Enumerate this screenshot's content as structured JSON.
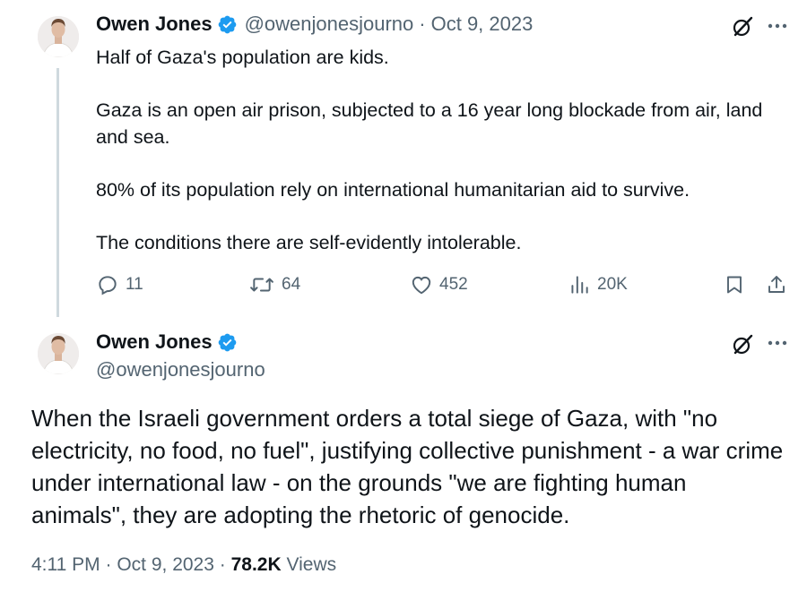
{
  "tweet1": {
    "author_name": "Owen Jones",
    "handle": "@owenjonesjourno",
    "separator": "·",
    "date": "Oct 9, 2023",
    "paragraphs": [
      "Half of Gaza's population are kids.",
      "Gaza is an open air prison, subjected to a 16 year long blockade from air, land and sea.",
      "80% of its population rely on international humanitarian aid to survive.",
      "The conditions there are self-evidently intolerable."
    ],
    "replies": "11",
    "reposts": "64",
    "likes": "452",
    "views": "20K"
  },
  "tweet2": {
    "author_name": "Owen Jones",
    "handle": "@owenjonesjourno",
    "text": "When the Israeli government orders a total siege of Gaza, with \"no electricity, no food, no fuel\", justifying collective punishment - a war crime under international law - on the grounds \"we are fighting human animals\", they are adopting the rhetoric of genocide.",
    "time": "4:11 PM",
    "separator": "·",
    "date": "Oct 9, 2023",
    "views_count": "78.2K",
    "views_label": "Views"
  },
  "icons": {
    "verified": "verified-badge-icon",
    "grok": "grok-icon",
    "more": "more-icon",
    "reply": "reply-icon",
    "repost": "repost-icon",
    "like": "like-icon",
    "views": "views-icon",
    "bookmark": "bookmark-icon",
    "share": "share-icon"
  },
  "colors": {
    "text": "#0f1419",
    "secondary": "#536471",
    "verified": "#1d9bf0",
    "thread_line": "#cfd9de"
  }
}
